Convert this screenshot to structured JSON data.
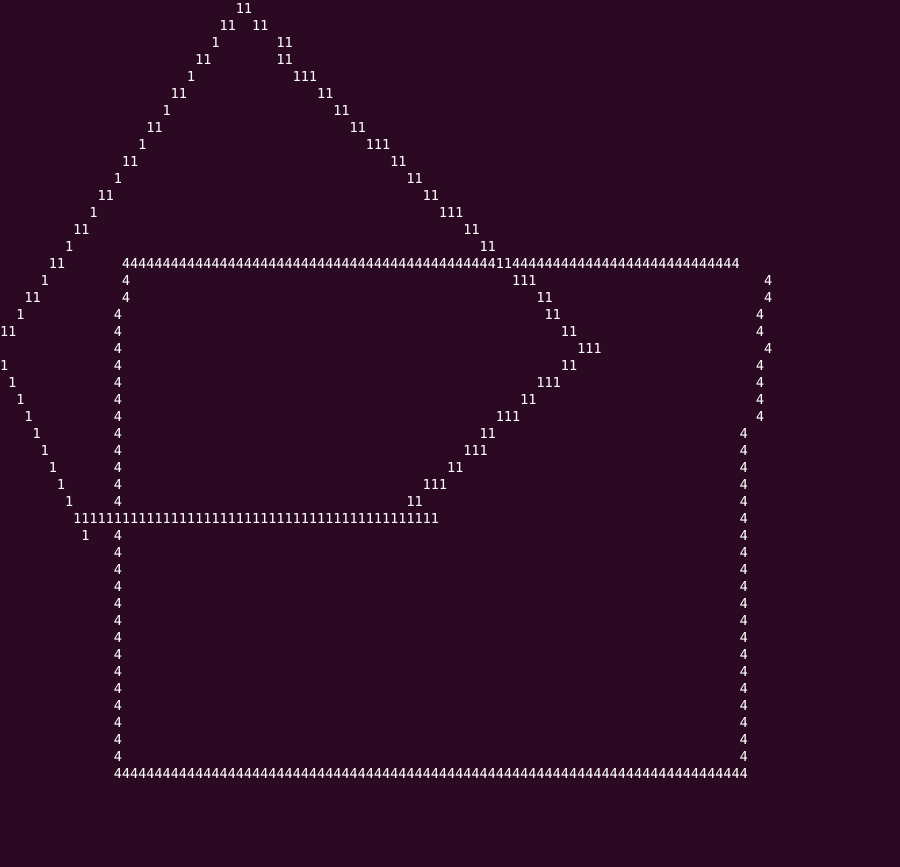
{
  "terminal": {
    "colors": {
      "background": "#2c0922",
      "foreground": "#ffffff"
    },
    "lines": [
      "                             11",
      "                           11  11",
      "                          1       11",
      "                        11        11",
      "                       1            111",
      "                     11                11",
      "                    1                    11",
      "                  11                       11",
      "                 1                           111",
      "               11                               11",
      "              1                                   11",
      "            11                                      11",
      "           1                                          111",
      "         11                                              11",
      "        1                                                  11",
      "      11       4444444444444444444444444444444444444444444444114444444444444444444444444444",
      "     1         4                                               111                            4",
      "   11          4                                                  11                          4",
      "  1           4                                                    11                        4",
      "11            4                                                      11                      4",
      "              4                                                        111                    4",
      "1             4                                                      11                      4",
      " 1            4                                                   111                        4",
      "  1           4                                                 11                           4",
      "   1          4                                              111                             4",
      "    1         4                                            11                              4",
      "     1        4                                          111                               4",
      "      1       4                                        11                                  4",
      "       1      4                                     111                                    4",
      "        1     4                                   11                                       4",
      "         111111111111111111111111111111111111111111111                                     4",
      "          1   4                                                                            4",
      "              4                                                                            4",
      "              4                                                                            4",
      "              4                                                                            4",
      "              4                                                                            4",
      "              4                                                                            4",
      "              4                                                                            4",
      "              4                                                                            4",
      "              4                                                                            4",
      "              4                                                                            4",
      "              4                                                                            4",
      "              4                                                                            4",
      "              4                                                                            4",
      "              4                                                                            4",
      "              444444444444444444444444444444444444444444444444444444444444444444444444444444"
    ]
  }
}
